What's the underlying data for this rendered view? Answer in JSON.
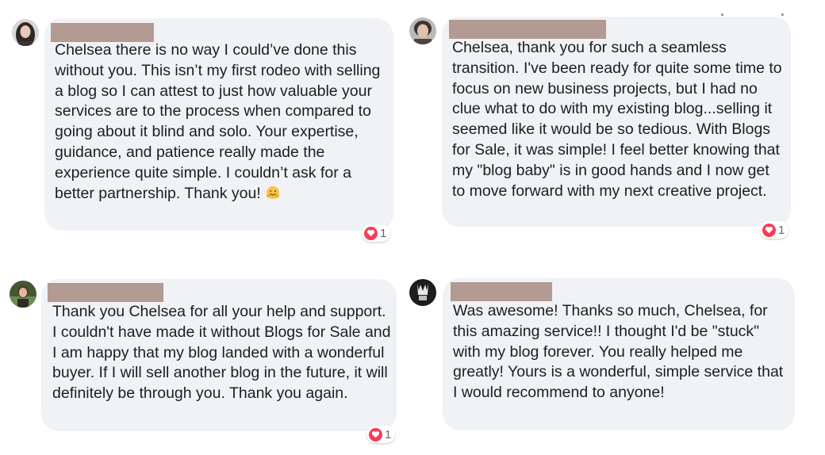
{
  "colors": {
    "bubble_bg": "#f0f2f5",
    "text": "#1c1e21",
    "redaction": "#b39a92",
    "reaction_heart": "#f33e58",
    "reaction_count": "#65676b"
  },
  "comments": [
    {
      "author_redacted": true,
      "text": "Chelsea there is no way I could’ve done this without you. This isn’t my first rodeo with selling a blog so I can attest to just how valuable your services are to the process when compared to going about it blind and solo. Your expertise, guidance, and patience really made the experience quite simple. I couldn’t ask for a better partnership. Thank you!",
      "emoji": "hugging-face-icon",
      "reaction_icon": "heart-icon",
      "reaction_count": "1"
    },
    {
      "author_redacted": true,
      "text": "Chelsea, thank you for such a seamless transition. I've been ready for quite some time to focus on new business projects, but I had no clue what to do with my existing blog...selling it seemed like it would be so tedious. With Blogs for Sale, it was simple! I feel better knowing that my \"blog baby\" is in good hands and I now get to move forward with my next creative project.",
      "reaction_icon": "heart-icon",
      "reaction_count": "1"
    },
    {
      "author_redacted": true,
      "text": "Thank you Chelsea for all your help and support. I couldn't have made it without Blogs for Sale and I am happy that my blog landed with a wonderful buyer. If I will sell another blog in the future, it will definitely be through you. Thank you again.",
      "reaction_icon": "heart-icon",
      "reaction_count": "1"
    },
    {
      "author_redacted": true,
      "text": "Was awesome! Thanks so much, Chelsea, for this amazing service!! I thought I'd be \"stuck\" with my blog forever. You really helped me greatly! Yours is a wonderful, simple service that I would recommend to anyone!"
    }
  ]
}
